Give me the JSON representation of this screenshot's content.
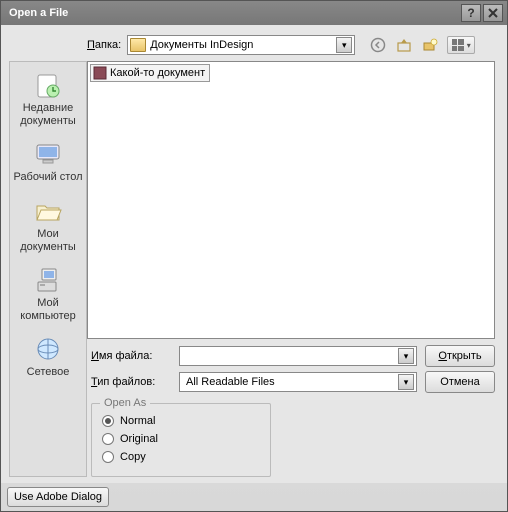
{
  "window": {
    "title": "Open a File"
  },
  "folder_row": {
    "label_prefix": "П",
    "label_rest": "апка:",
    "selected": "Документы InDesign"
  },
  "icons": {
    "back": "back-icon",
    "up": "up-one-level-icon",
    "new_folder": "new-folder-icon",
    "views": "views-icon"
  },
  "places": [
    {
      "id": "recent",
      "label": "Недавние документы"
    },
    {
      "id": "desktop",
      "label": "Рабочий стол"
    },
    {
      "id": "mydocs",
      "label": "Мои документы"
    },
    {
      "id": "mycomp",
      "label": "Мой компьютер"
    },
    {
      "id": "network",
      "label": "Сетевое"
    }
  ],
  "file_list": [
    {
      "name": "Какой-то документ"
    }
  ],
  "filename_row": {
    "label_u": "И",
    "label_rest": "мя файла:",
    "value": ""
  },
  "filetype_row": {
    "label_u": "Т",
    "label_rest": "ип файлов:",
    "value": "All Readable Files"
  },
  "buttons": {
    "open_u": "О",
    "open_rest": "ткрыть",
    "cancel": "Отмена",
    "use_adobe": "Use Adobe Dialog"
  },
  "open_as": {
    "legend": "Open As",
    "options": [
      {
        "key": "normal",
        "u": "N",
        "rest": "ormal",
        "selected": true
      },
      {
        "key": "original",
        "u": "",
        "rest": "Original",
        "selected": false
      },
      {
        "key": "copy",
        "u": "C",
        "rest": "opy",
        "selected": false
      }
    ]
  }
}
